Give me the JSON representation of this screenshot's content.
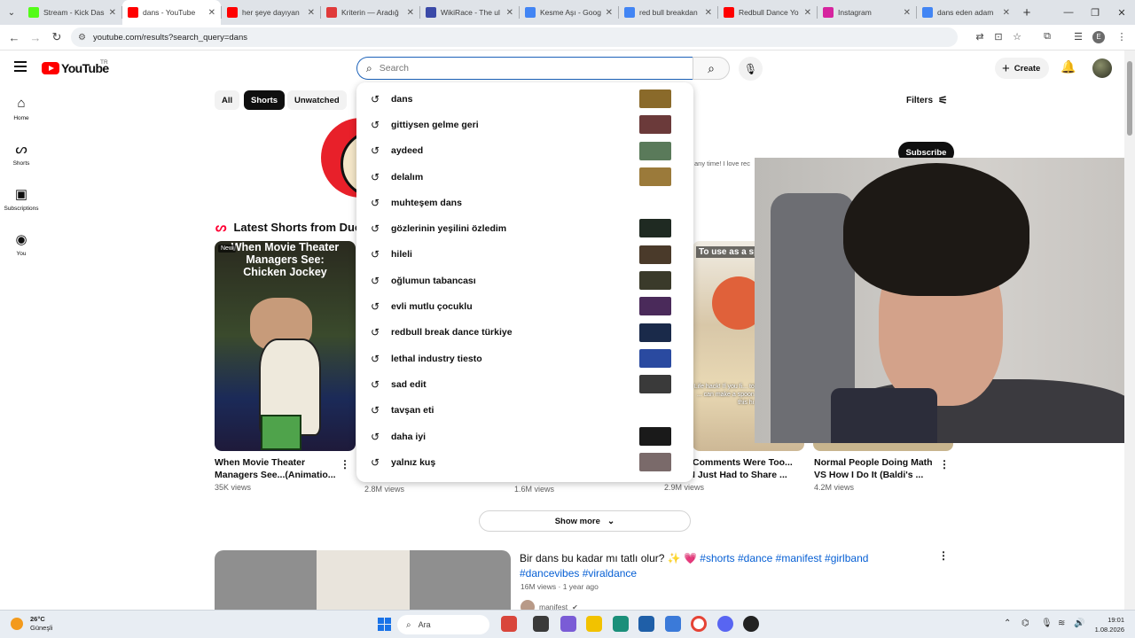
{
  "browser": {
    "tabs": [
      {
        "title": "Stream - Kick Das",
        "favicon_color": "#53fc18",
        "active": false
      },
      {
        "title": "dans - YouTube",
        "favicon_color": "#ff0000",
        "active": true
      },
      {
        "title": "her şeye dayıyan",
        "favicon_color": "#ff0000",
        "active": false
      },
      {
        "title": "Kriterin — Aradığ",
        "favicon_color": "#e03a3a",
        "active": false
      },
      {
        "title": "WikiRace - The ul",
        "favicon_color": "#3b4aa8",
        "active": false
      },
      {
        "title": "Kesme Aşı - Goog",
        "favicon_color": "#4285f4",
        "active": false
      },
      {
        "title": "red bull breakdan",
        "favicon_color": "#4285f4",
        "active": false
      },
      {
        "title": "Redbull Dance Yo",
        "favicon_color": "#ff0000",
        "active": false
      },
      {
        "title": "Instagram",
        "favicon_color": "#d6249f",
        "active": false
      },
      {
        "title": "dans eden adam",
        "favicon_color": "#4285f4",
        "active": false
      }
    ],
    "url": "youtube.com/results?search_query=dans",
    "profile_initial": "E"
  },
  "yt": {
    "logo_text": "YouTube",
    "country_code": "TR",
    "search_placeholder": "Search",
    "create_label": "Create",
    "guide": [
      {
        "label": "Home",
        "icon": "⌂"
      },
      {
        "label": "Shorts",
        "icon": "ᔕ"
      },
      {
        "label": "Subscriptions",
        "icon": "▣"
      },
      {
        "label": "You",
        "icon": "◉"
      }
    ],
    "chips": [
      "All",
      "Shorts",
      "Unwatched"
    ],
    "filters_label": "Filters",
    "channel_desc": "any time! I love rec",
    "subscribe_label": "Subscribe",
    "shorts_section_title": "Latest Shorts from Duc",
    "shorts": [
      {
        "thumb_cap1": "When Movie Theater Managers See:",
        "thumb_cap2": "Chicken Jockey",
        "badge": "New",
        "title": "When Movie Theater Managers See...(Animatio...",
        "views": "35K views"
      },
      {
        "views": "2.8M views"
      },
      {
        "views": "1.6M views"
      },
      {
        "thumb_cap": "To use as a sp",
        "thumb_overlay": "Life hack! If you fi... toilet plunger inside ... can make a spoon fo... soup! Hope this hi...",
        "title": "Comments Were Too... I Just Had to Share ...",
        "views": "2.9M views"
      },
      {
        "title": "Normal People Doing Math VS How I Do It (Baldi's ...",
        "views": "4.2M views"
      }
    ],
    "show_more_label": "Show more",
    "video": {
      "title_plain": "Bir dans bu kadar mı tatlı olur? ✨ 💗 ",
      "title_tags": "#shorts #dance #manifest #girlband #dancevibes #viraldance",
      "meta": "16M views · 1 year ago",
      "channel": "manifest"
    },
    "suggestions": [
      {
        "text": "dans",
        "thumb": "#8a6a2a"
      },
      {
        "text": "gittiysen gelme geri",
        "thumb": "#6b3a3a"
      },
      {
        "text": "aydeed",
        "thumb": "#5a7a5a"
      },
      {
        "text": "delalım",
        "thumb": "#9b7a3a"
      },
      {
        "text": "muhteşem dans",
        "thumb": ""
      },
      {
        "text": "gözlerinin yeşilini özledim",
        "thumb": "#1f2a22"
      },
      {
        "text": "hileli",
        "thumb": "#4a3a2a"
      },
      {
        "text": "oğlumun tabancası",
        "thumb": "#3a3a2a"
      },
      {
        "text": "evli mutlu çocuklu",
        "thumb": "#4a2a5a"
      },
      {
        "text": "redbull break dance türkiye",
        "thumb": "#1a2a4a"
      },
      {
        "text": "lethal industry tiesto",
        "thumb": "#2a4aa0"
      },
      {
        "text": "sad edit",
        "thumb": "#3a3a3a"
      },
      {
        "text": "tavşan eti",
        "thumb": ""
      },
      {
        "text": "daha iyi",
        "thumb": "#1a1a1a"
      },
      {
        "text": "yalnız kuş",
        "thumb": "#7a6a6a"
      }
    ]
  },
  "taskbar": {
    "temp": "26°C",
    "weather": "Güneşli",
    "search_label": "Ara",
    "time": "19:01",
    "date": "1.08.2026"
  },
  "icons": {
    "search": "search-icon",
    "history": "history-icon",
    "mic": "mic-icon",
    "bell": "bell-icon"
  }
}
